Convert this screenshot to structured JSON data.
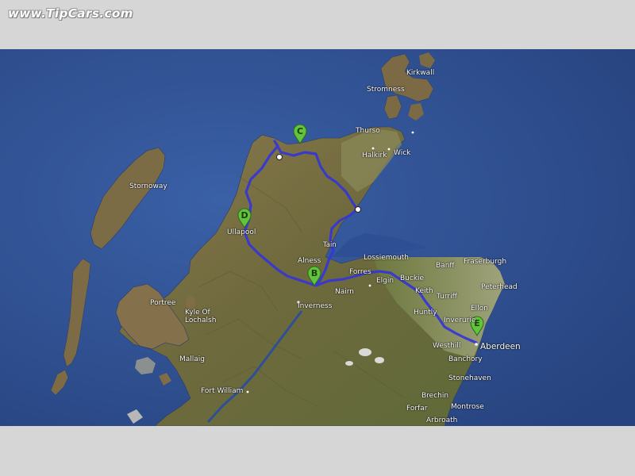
{
  "watermark": "www.TipCars.com",
  "colors": {
    "sea": "#2f4f95",
    "land": "#7d6a42",
    "route": "#3a3ad8",
    "marker": "#5bc236",
    "band": "#d6d6d6"
  },
  "markers": [
    {
      "id": "B",
      "label": "B"
    },
    {
      "id": "C",
      "label": "C"
    },
    {
      "id": "D",
      "label": "D"
    },
    {
      "id": "E",
      "label": "E"
    }
  ],
  "places": {
    "kirkwall": "Kirkwall",
    "stromness": "Stromness",
    "thurso": "Thurso",
    "halkirk": "Halkirk",
    "wick": "Wick",
    "stornoway": "Stornoway",
    "ullapool": "Ullapool",
    "alness": "Alness",
    "lossiemouth": "Lossiemouth",
    "banff": "Banff",
    "fraserburgh": "Fraserburgh",
    "peterhead": "Peterhead",
    "forres": "Forres",
    "elgin": "Elgin",
    "buckie": "Buckie",
    "nairn": "Nairn",
    "keith": "Keith",
    "turriff": "Turriff",
    "ellon": "Ellon",
    "inverness": "Inverness",
    "huntly": "Huntly",
    "inverurie": "Inverurie",
    "portree": "Portree",
    "kyle": "Kyle Of\nLochalsh",
    "westhill": "Westhill",
    "aberdeen": "Aberdeen",
    "banchory": "Banchory",
    "mallaig": "Mallaig",
    "stonehaven": "Stonehaven",
    "fortwilliam": "Fort William",
    "brechin": "Brechin",
    "montrose": "Montrose",
    "forfar": "Forfar",
    "arbroath": "Arbroath",
    "tain": "Tain"
  }
}
